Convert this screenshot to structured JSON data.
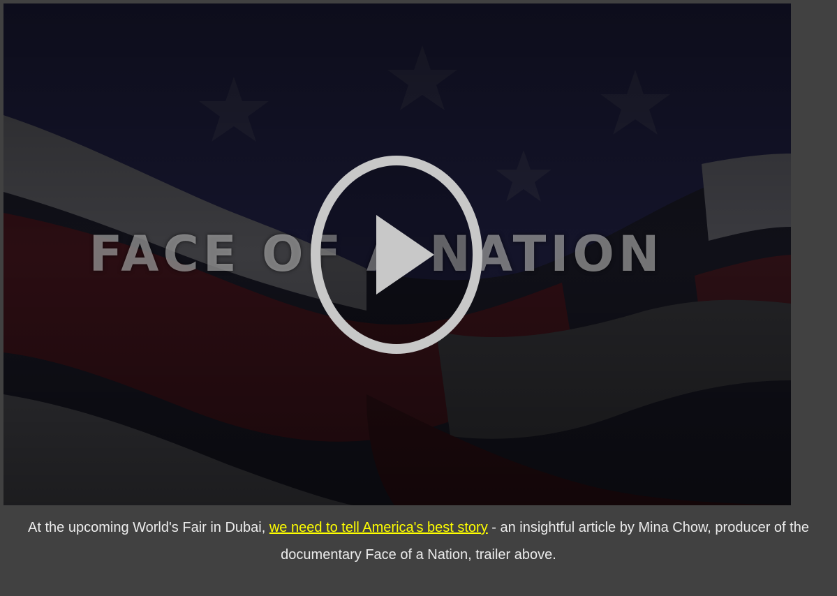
{
  "video": {
    "title_overlay": "FACE OF A NATION",
    "play_icon": "play-circle-icon"
  },
  "caption": {
    "text_before_link": "At the upcoming World's Fair in Dubai, ",
    "link_text": "we need to tell America's best story",
    "text_after_link": " - an insightful article by Mina Chow, producer of the documentary Face of a Nation, trailer above."
  },
  "colors": {
    "page_background": "#414141",
    "link": "#ffff00",
    "caption_text": "#ececec"
  }
}
